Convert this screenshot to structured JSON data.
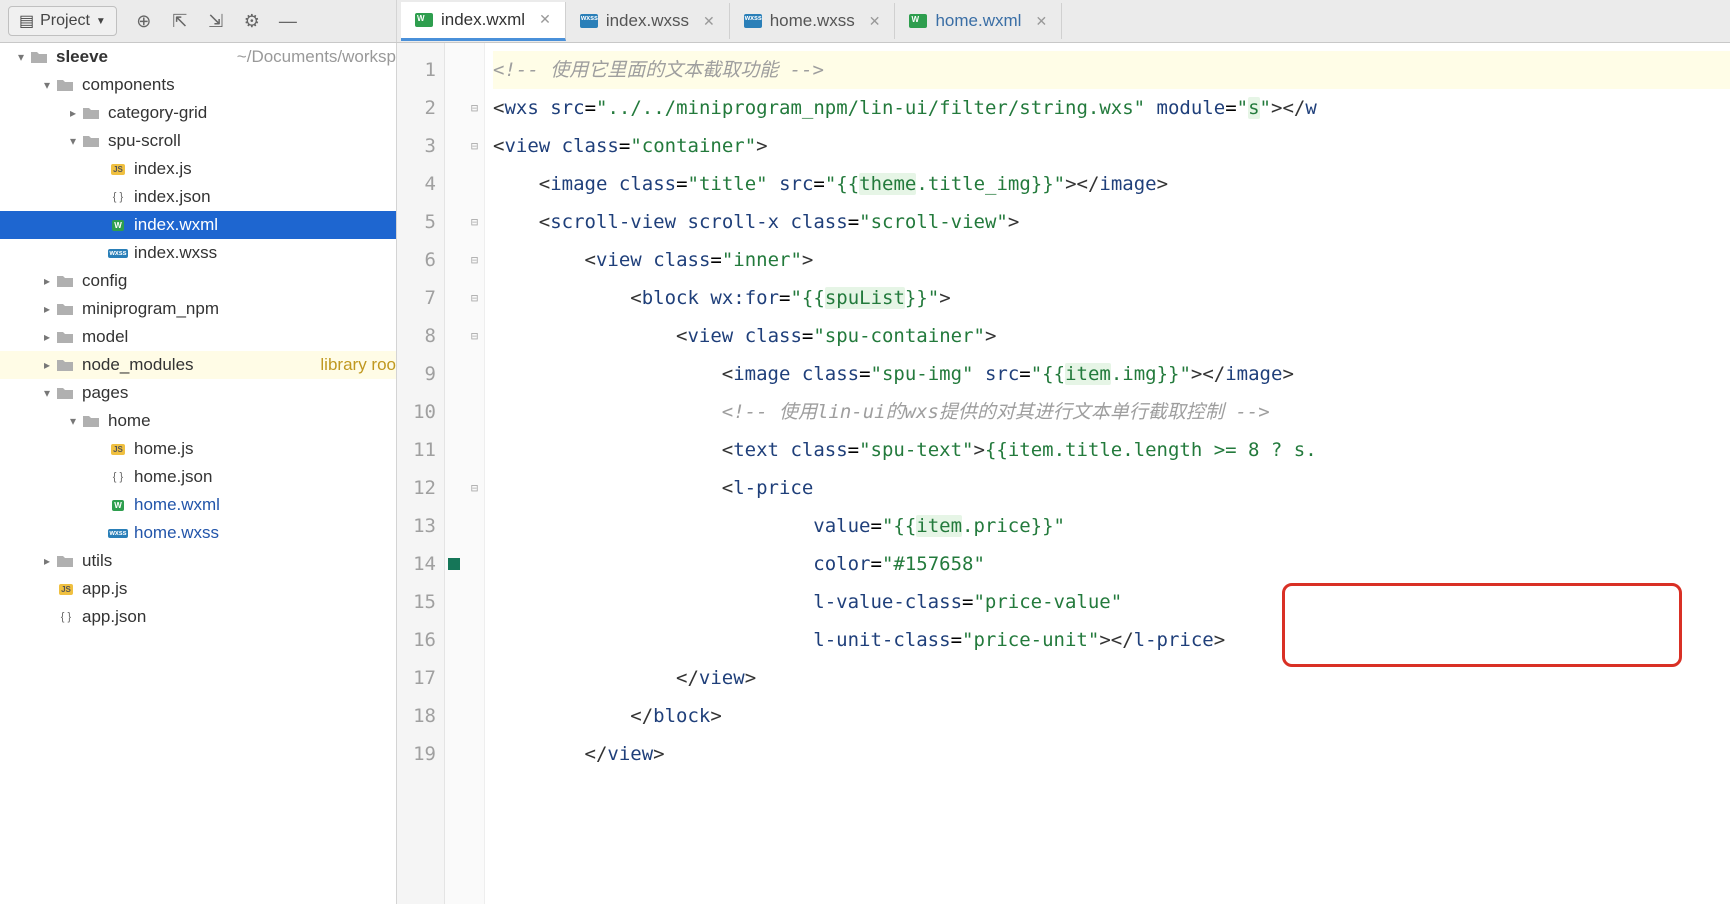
{
  "toolbar": {
    "project_label": "Project"
  },
  "tabs": [
    {
      "name": "index.wxml",
      "type": "wxml",
      "active": true
    },
    {
      "name": "index.wxss",
      "type": "wxss",
      "active": false
    },
    {
      "name": "home.wxss",
      "type": "wxss",
      "active": false
    },
    {
      "name": "home.wxml",
      "type": "wxml",
      "active": false,
      "modified": true
    }
  ],
  "tree": {
    "root": {
      "name": "sleeve",
      "hint": "~/Documents/worksp"
    },
    "items": [
      {
        "indent": 1,
        "type": "folder",
        "name": "components",
        "expanded": true
      },
      {
        "indent": 2,
        "type": "folder",
        "name": "category-grid",
        "expanded": false
      },
      {
        "indent": 2,
        "type": "folder",
        "name": "spu-scroll",
        "expanded": true
      },
      {
        "indent": 3,
        "type": "file",
        "name": "index.js",
        "ftype": "js"
      },
      {
        "indent": 3,
        "type": "file",
        "name": "index.json",
        "ftype": "json"
      },
      {
        "indent": 3,
        "type": "file",
        "name": "index.wxml",
        "ftype": "wxml",
        "selected": true
      },
      {
        "indent": 3,
        "type": "file",
        "name": "index.wxss",
        "ftype": "wxss"
      },
      {
        "indent": 1,
        "type": "folder",
        "name": "config",
        "expanded": false
      },
      {
        "indent": 1,
        "type": "folder",
        "name": "miniprogram_npm",
        "expanded": false
      },
      {
        "indent": 1,
        "type": "folder",
        "name": "model",
        "expanded": false
      },
      {
        "indent": 1,
        "type": "folder",
        "name": "node_modules",
        "expanded": false,
        "hint": "library roo",
        "library": true
      },
      {
        "indent": 1,
        "type": "folder",
        "name": "pages",
        "expanded": true
      },
      {
        "indent": 2,
        "type": "folder",
        "name": "home",
        "expanded": true
      },
      {
        "indent": 3,
        "type": "file",
        "name": "home.js",
        "ftype": "js"
      },
      {
        "indent": 3,
        "type": "file",
        "name": "home.json",
        "ftype": "json"
      },
      {
        "indent": 3,
        "type": "file",
        "name": "home.wxml",
        "ftype": "wxml",
        "modified": true
      },
      {
        "indent": 3,
        "type": "file",
        "name": "home.wxss",
        "ftype": "wxss",
        "modified": true
      },
      {
        "indent": 1,
        "type": "folder",
        "name": "utils",
        "expanded": false
      },
      {
        "indent": 1,
        "type": "file",
        "name": "app.js",
        "ftype": "js"
      },
      {
        "indent": 1,
        "type": "file",
        "name": "app.json",
        "ftype": "json"
      }
    ]
  },
  "editor": {
    "lines": [
      1,
      2,
      3,
      4,
      5,
      6,
      7,
      8,
      9,
      10,
      11,
      12,
      13,
      14,
      15,
      16,
      17,
      18,
      19
    ],
    "code": {
      "l1_comment": "<!-- 使用它里面的文本截取功能 -->",
      "l2_tag": "wxs",
      "l2_src": "../../miniprogram_npm/lin-ui/filter/string.wxs",
      "l2_module": "s",
      "l3_tag": "view",
      "l3_cls": "container",
      "l4_tag": "image",
      "l4_cls": "title",
      "l4_src_pre": "{{",
      "l4_src_obj": "theme",
      "l4_src_prop": "title_img",
      "l4_src_post": "}}",
      "l5_tag": "scroll-view",
      "l5_attr": "scroll-x",
      "l5_cls": "scroll-view",
      "l6_tag": "view",
      "l6_cls": "inner",
      "l7_tag": "block",
      "l7_attr": "wx:for",
      "l7_val_pre": "{{",
      "l7_val": "spuList",
      "l7_val_post": "}}",
      "l8_tag": "view",
      "l8_cls": "spu-container",
      "l9_tag": "image",
      "l9_cls": "spu-img",
      "l9_src_pre": "{{",
      "l9_src_obj": "item",
      "l9_src_prop": "img",
      "l9_src_post": "}}",
      "l10_comment": "<!-- 使用lin-ui的wxs提供的对其进行文本单行截取控制 -->",
      "l11_tag": "text",
      "l11_cls": "spu-text",
      "l11_expr": "{{item.title.length >= 8 ? s.",
      "l12_tag": "l-price",
      "l13_attr": "value",
      "l13_val_pre": "{{",
      "l13_val_obj": "item",
      "l13_val_prop": "price",
      "l13_val_post": "}}",
      "l14_attr": "color",
      "l14_val": "#157658",
      "l15_attr": "l-value-class",
      "l15_val": "price-value",
      "l16_attr": "l-unit-class",
      "l16_val": "price-unit",
      "l16_close": "l-price",
      "l17_close": "view",
      "l18_close": "block",
      "l19_close": "view"
    }
  }
}
